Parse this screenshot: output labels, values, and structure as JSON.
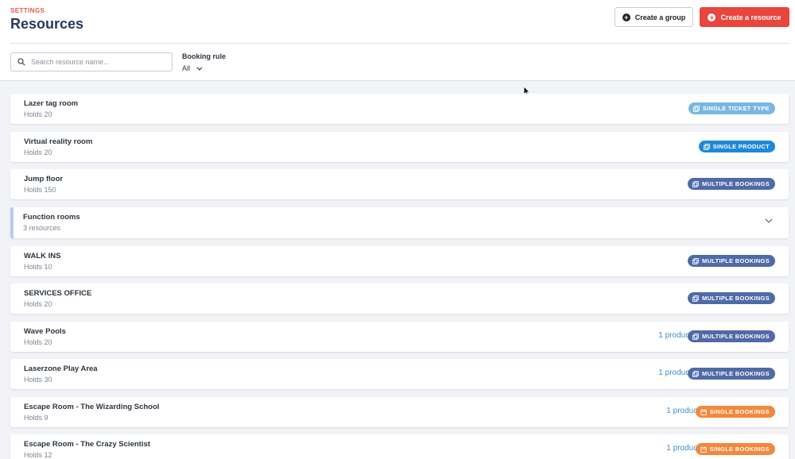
{
  "header": {
    "eyebrow": "SETTINGS",
    "title": "Resources",
    "create_group_label": "Create a group",
    "create_resource_label": "Create a resource"
  },
  "filters": {
    "search_placeholder": "Search resource name...",
    "booking_rule_label": "Booking rule",
    "booking_rule_value": "All"
  },
  "colors": {
    "accent_red": "#e8453c",
    "title_navy": "#243a5e",
    "badge_single_ticket": "#79b7e3",
    "badge_single_product": "#1f88d8",
    "badge_multiple": "#4f6aa6",
    "badge_single_bookings": "#f4873b"
  },
  "rows": [
    {
      "name": "Lazer tag room",
      "sub": "Holds 20",
      "badge": "SINGLE TICKET TYPE",
      "product": ""
    },
    {
      "name": "Virtual reality room",
      "sub": "Holds 20",
      "badge": "SINGLE PRODUCT",
      "product": ""
    },
    {
      "name": "Jump floor",
      "sub": "Holds 150",
      "badge": "MULTIPLE BOOKINGS",
      "product": ""
    },
    {
      "name": "Function rooms",
      "sub": "3 resources",
      "badge": "",
      "product": ""
    },
    {
      "name": "WALK INS",
      "sub": "Holds 10",
      "badge": "MULTIPLE BOOKINGS",
      "product": ""
    },
    {
      "name": "SERVICES OFFICE",
      "sub": "Holds 20",
      "badge": "MULTIPLE BOOKINGS",
      "product": ""
    },
    {
      "name": "Wave Pools",
      "sub": "Holds 20",
      "badge": "MULTIPLE BOOKINGS",
      "product": "1 product"
    },
    {
      "name": "Laserzone Play Area",
      "sub": "Holds 30",
      "badge": "MULTIPLE BOOKINGS",
      "product": "1 product"
    },
    {
      "name": "Escape Room - The Wizarding School",
      "sub": "Holds 9",
      "badge": "SINGLE BOOKINGS",
      "product": "1 product"
    },
    {
      "name": "Escape Room - The Crazy Scientist",
      "sub": "Holds 12",
      "badge": "SINGLE BOOKINGS",
      "product": "1 product"
    }
  ]
}
